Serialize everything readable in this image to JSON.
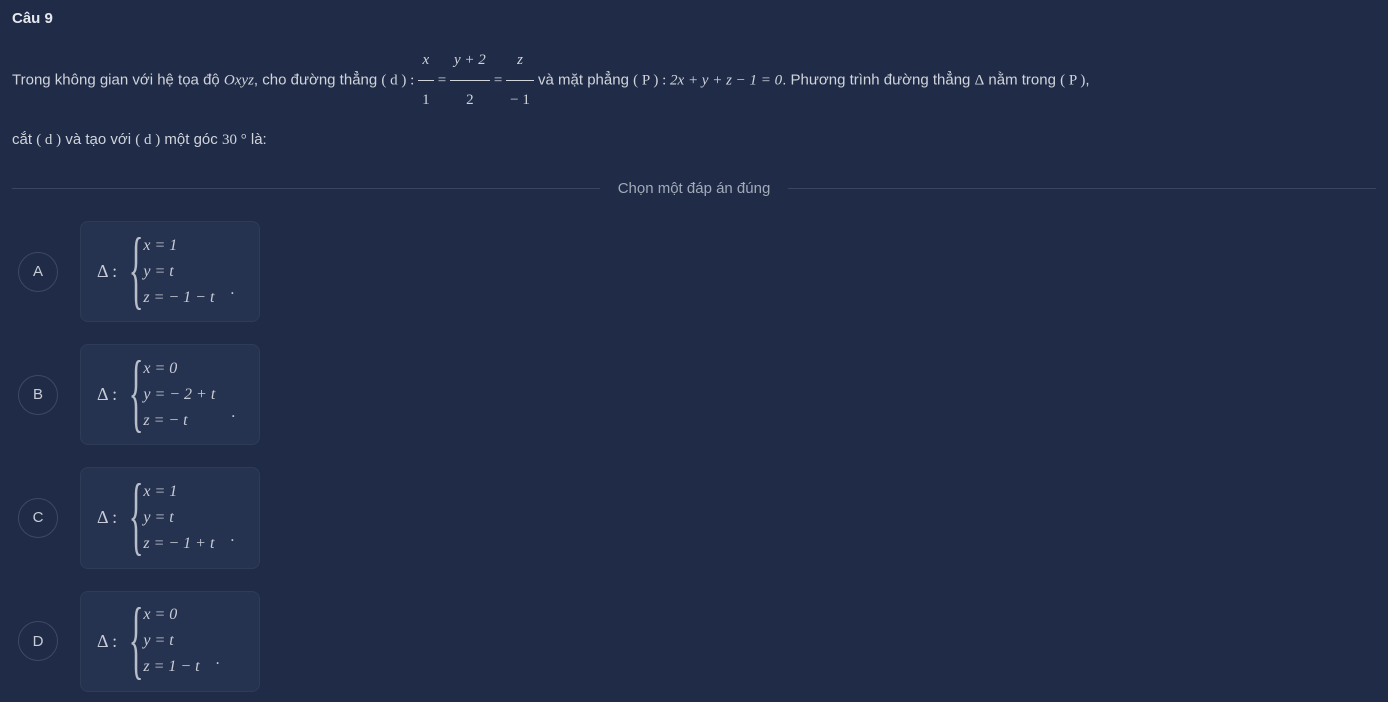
{
  "question": {
    "title": "Câu 9",
    "prefix": "Trong không gian với hệ tọa độ ",
    "oxyz": "Oxyz",
    "afterOxyz": ", cho đường thẳng ",
    "d_label": "( d ) : ",
    "frac1_num": "x",
    "frac1_den": "1",
    "eq": " = ",
    "frac2_num": "y + 2",
    "frac2_den": "2",
    "frac3_num": "z",
    "frac3_den": "− 1",
    "afterFrac": " và mặt phẳng ",
    "p_label": "( P ) : ",
    "plane_eq": "2x + y + z − 1 = 0",
    "afterPlane": ". Phương trình đường thẳng ",
    "delta": "Δ",
    "inPlane": " nằm trong ",
    "p2": "( P )",
    "comma": ",",
    "line2a": "cắt ",
    "d2": "( d )",
    "line2b": " và tạo với ",
    "d3": "( d )",
    "line2c": " một góc ",
    "angle": "30 °",
    "line2d": " là:"
  },
  "divider": "Chọn một đáp án đúng",
  "options": [
    {
      "letter": "A",
      "eq1": "x = 1",
      "eq2": "y = t",
      "eq3": "z = − 1 − t"
    },
    {
      "letter": "B",
      "eq1": "x = 0",
      "eq2": "y = − 2 + t",
      "eq3": "z = − t"
    },
    {
      "letter": "C",
      "eq1": "x = 1",
      "eq2": "y = t",
      "eq3": "z = − 1 + t"
    },
    {
      "letter": "D",
      "eq1": "x = 0",
      "eq2": "y = t",
      "eq3": "z = 1 − t"
    }
  ],
  "deltaColon": "Δ :",
  "period": "."
}
